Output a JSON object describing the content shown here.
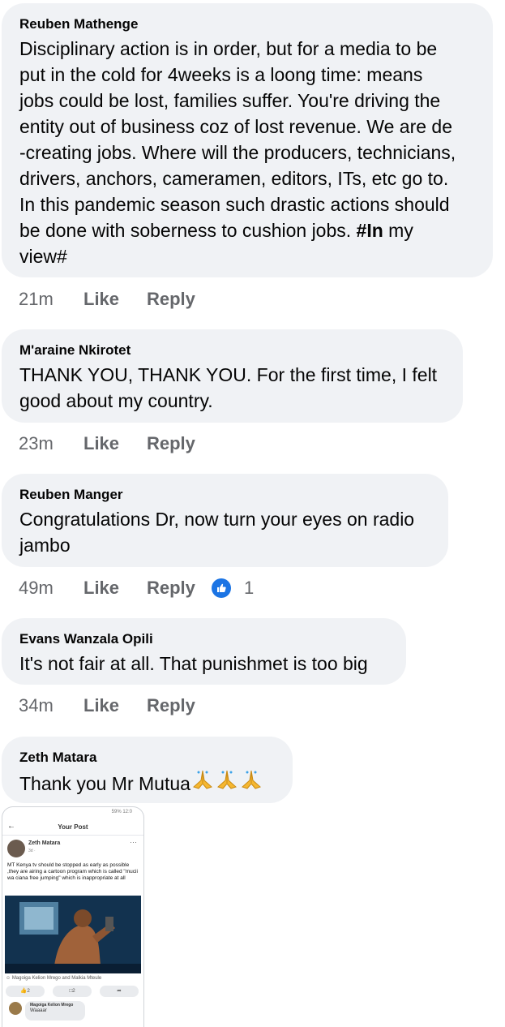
{
  "comments": [
    {
      "author": "Reuben Mathenge",
      "text_lines": [
        "Disciplinary action is in order, but for a media to be",
        "put in the cold for 4weeks is a loong time: means",
        "jobs could be lost, families suffer. You're driving the",
        "entity out of business coz of lost revenue. We are de",
        "-creating jobs. Where will the producers, technicians,",
        "drivers, anchors, cameramen, editors, ITs, etc go to.",
        "In this pandemic season such drastic actions should"
      ],
      "last_line_pre": "be done with soberness to cushion jobs. ",
      "last_line_bold": "#In",
      "last_line_post": " my",
      "extra_line": "view#",
      "time": "21m",
      "like_label": "Like",
      "reply_label": "Reply"
    },
    {
      "author": "M'araine Nkirotet",
      "text_lines": [
        "THANK YOU, THANK YOU. For the first time, I felt",
        "good about my country."
      ],
      "time": "23m",
      "like_label": "Like",
      "reply_label": "Reply"
    },
    {
      "author": "Reuben Manger",
      "text_lines": [
        "Congratulations Dr, now turn your eyes on radio",
        "jambo"
      ],
      "time": "49m",
      "like_label": "Like",
      "reply_label": "Reply",
      "reaction_count": "1"
    },
    {
      "author": "Evans Wanzala Opili",
      "text_lines": [
        "It's not fair at all. That punishmet is too big"
      ],
      "time": "34m",
      "like_label": "Like",
      "reply_label": "Reply"
    },
    {
      "author": "Zeth Matara",
      "text_lines": [
        "Thank you Mr Mutua"
      ],
      "emoji_icons": [
        "folded-hands",
        "folded-hands",
        "folded-hands"
      ]
    }
  ],
  "attachment": {
    "status_bar": "59%  12:0",
    "title": "Your Post",
    "author": "Zeth Matara",
    "author_meta": "3d · ",
    "body": "MT Kenya tv should be stopped as early as possible ,they are airing a cartoon program which is called \"mucii wa ciana free jumping\" which is inappropriate at all",
    "reactions_text": "Magoiga Kelion Mrego and Malkia Mteule",
    "like_count": "2",
    "comment_count": "2",
    "commenter": "Magoiga Kelion Mrego",
    "comment_text": "Waaaar"
  },
  "colors": {
    "bubble": "#f0f2f5",
    "meta_text": "#65676b",
    "like_badge": "#1b74e4"
  }
}
